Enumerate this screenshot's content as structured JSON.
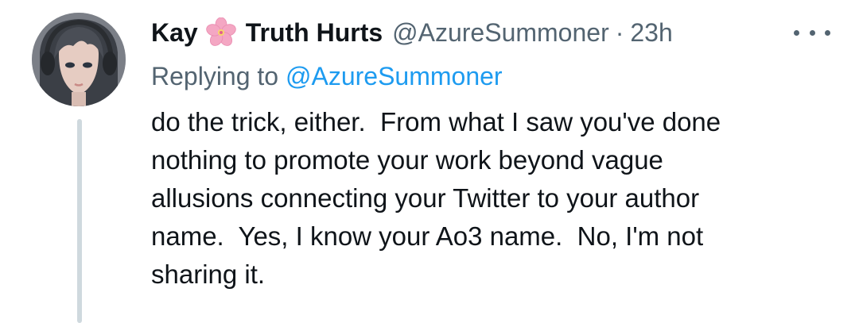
{
  "tweet": {
    "author_name": "Kay",
    "author_name_suffix": "Truth Hurts",
    "handle": "@AzureSummoner",
    "separator": "·",
    "timestamp": "23h",
    "replying_prefix": "Replying to ",
    "replying_to": "@AzureSummoner",
    "body_lines": [
      "do the trick, either.  From what I saw you've done",
      "nothing to promote your work beyond vague",
      "allusions connecting your Twitter to your author",
      "name.  Yes, I know your Ao3 name.  No, I'm not",
      "sharing it."
    ]
  },
  "icons": {
    "name_emoji": "cherry-blossom-icon",
    "more": "more-options-icon"
  },
  "colors": {
    "text_primary": "#0f1419",
    "text_secondary": "#536471",
    "link": "#1d9bf0",
    "thread_line": "#cfd9de",
    "flower": "#f4a7c3"
  }
}
